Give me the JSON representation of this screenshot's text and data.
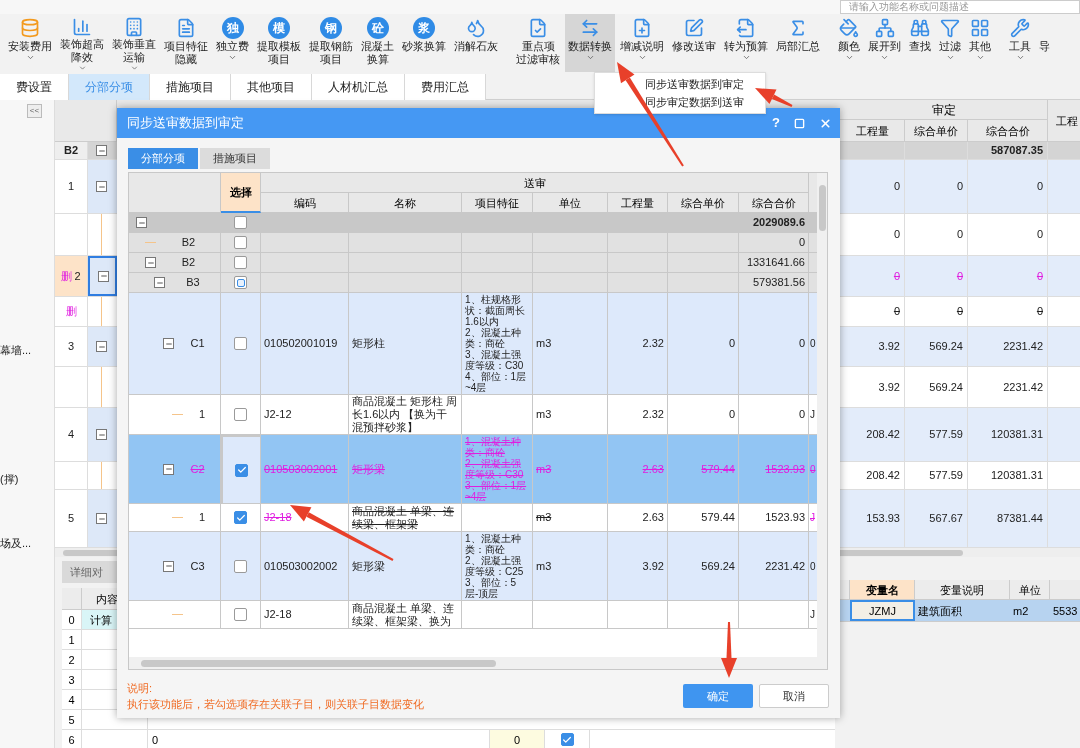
{
  "search": {
    "placeholder": "请输入功能名称或问题描述"
  },
  "toolbar": [
    [
      {
        "label": "安装费用",
        "dropdown": true,
        "selected": false
      },
      {
        "label": [
          "装饰超高",
          "降效"
        ],
        "dropdown": true,
        "selected": false
      },
      {
        "label": [
          "装饰垂直",
          "运输"
        ],
        "dropdown": true,
        "selected": false
      },
      {
        "label": [
          "项目特征",
          "隐藏"
        ],
        "dropdown": false,
        "selected": false
      },
      {
        "label": "独立费",
        "badge": "独",
        "dropdown": true,
        "selected": false
      },
      {
        "label": [
          "提取模板",
          "项目"
        ],
        "badge": "模",
        "dropdown": false,
        "selected": false
      },
      {
        "label": [
          "提取钢筋",
          "项目"
        ],
        "badge": "钢",
        "dropdown": false,
        "selected": false
      },
      {
        "label": [
          "混凝土",
          "换算"
        ],
        "badge": "砼",
        "dropdown": false,
        "selected": false
      },
      {
        "label": "砂浆换算",
        "badge": "浆",
        "dropdown": false,
        "selected": false
      },
      {
        "label": "消解石灰",
        "dropdown": false,
        "selected": false
      }
    ],
    [
      {
        "label": [
          "重点项",
          "过滤审核"
        ],
        "dropdown": false,
        "selected": false
      },
      {
        "label": "数据转换",
        "dropdown": true,
        "selected": true
      },
      {
        "label": "增减说明",
        "dropdown": true,
        "selected": false
      },
      {
        "label": "修改送审",
        "dropdown": false,
        "selected": false
      },
      {
        "label": "转为预算",
        "dropdown": true,
        "selected": false
      },
      {
        "label": "局部汇总",
        "dropdown": false,
        "selected": false
      }
    ],
    [
      {
        "label": "颜色",
        "dropdown": true,
        "selected": false
      },
      {
        "label": "展开到",
        "dropdown": true,
        "selected": false
      },
      {
        "label": "查找",
        "dropdown": false,
        "selected": false
      },
      {
        "label": "过滤",
        "dropdown": true,
        "selected": false
      },
      {
        "label": "其他",
        "dropdown": true,
        "selected": false
      }
    ],
    [
      {
        "label": "工具",
        "dropdown": true,
        "selected": false
      },
      {
        "label": "导",
        "dropdown": false,
        "selected": false
      }
    ]
  ],
  "menu": [
    "同步送审数据到审定",
    "同步审定数据到送审"
  ],
  "tabs": [
    {
      "label": "费设置",
      "selected": false
    },
    {
      "label": "分部分项",
      "selected": true
    },
    {
      "label": "措施项目",
      "selected": false
    },
    {
      "label": "其他项目",
      "selected": false
    },
    {
      "label": "人材机汇总",
      "selected": false
    },
    {
      "label": "费用汇总",
      "selected": false
    }
  ],
  "sidebar": {
    "collapse": "<<",
    "items": [
      "幕墙...",
      "(撑)",
      "场及..."
    ]
  },
  "grid": {
    "header_group": "审定",
    "columns": [
      "工程量",
      "综合单价",
      "综合合价"
    ],
    "column_cut": "工程",
    "rows": [
      {
        "kind": "summary",
        "number": "B2",
        "expanded": true,
        "selected": false,
        "deleted": false,
        "total": "587087.35"
      },
      {
        "kind": "item",
        "number": "1",
        "expanded": true,
        "selected": false,
        "deleted": false,
        "quantity": "0",
        "unit_price": "0",
        "total": "0"
      },
      {
        "kind": "sub",
        "selected": false,
        "deleted": false,
        "quantity": "0",
        "unit_price": "0",
        "total": "0"
      },
      {
        "kind": "item",
        "number": "2",
        "tag": "删",
        "expanded": true,
        "selected": true,
        "deleted": true,
        "quantity": "0",
        "unit_price": "0",
        "total": "0"
      },
      {
        "kind": "sub",
        "tag": "删",
        "selected": false,
        "deleted": true,
        "quantity": "0",
        "unit_price": "0",
        "total": "0"
      },
      {
        "kind": "item",
        "number": "3",
        "expanded": true,
        "selected": false,
        "deleted": false,
        "quantity": "3.92",
        "unit_price": "569.24",
        "total": "2231.42"
      },
      {
        "kind": "sub",
        "selected": false,
        "deleted": false,
        "quantity": "3.92",
        "unit_price": "569.24",
        "total": "2231.42"
      },
      {
        "kind": "item",
        "number": "4",
        "expanded": true,
        "selected": false,
        "deleted": false,
        "quantity": "208.42",
        "unit_price": "577.59",
        "total": "120381.31"
      },
      {
        "kind": "sub",
        "selected": false,
        "deleted": false,
        "quantity": "208.42",
        "unit_price": "577.59",
        "total": "120381.31"
      },
      {
        "kind": "item",
        "number": "5",
        "expanded": true,
        "selected": false,
        "deleted": false,
        "quantity": "153.93",
        "unit_price": "567.67",
        "total": "87381.44"
      }
    ]
  },
  "detail": {
    "tab": "详细对",
    "column": "内容",
    "rows": [
      {
        "number": "0",
        "content": "计算"
      },
      {
        "number": "1"
      },
      {
        "number": "2"
      },
      {
        "number": "3"
      },
      {
        "number": "4"
      },
      {
        "number": "5"
      },
      {
        "number": "6",
        "value": "0",
        "amount": "0",
        "checked": true
      }
    ]
  },
  "variables": {
    "columns": [
      "变量名",
      "变量说明",
      "单位"
    ],
    "rows": [
      {
        "name": "JZMJ",
        "description": "建筑面积",
        "unit": "m2",
        "value": "5533"
      }
    ]
  },
  "dialog": {
    "title": "同步送审数据到审定",
    "help": "?",
    "tabs": [
      {
        "label": "分部分项",
        "selected": true
      },
      {
        "label": "措施项目",
        "selected": false
      }
    ],
    "table": {
      "select_column": "选择",
      "group": "送审",
      "columns": [
        "编码",
        "名称",
        "项目特征",
        "单位",
        "工程量",
        "综合单价",
        "综合合价"
      ],
      "rows": [
        {
          "kind": "summary",
          "expanded": true,
          "checked": false,
          "partial": false,
          "selected": false,
          "deleted": false,
          "total": "2029089.6",
          "children": [
            {
              "kind": "group",
              "label": "B2",
              "checked": false,
              "partial": false,
              "selected": false,
              "deleted": false,
              "total": "0"
            },
            {
              "kind": "group",
              "label": "B2",
              "expanded": true,
              "checked": false,
              "partial": false,
              "selected": false,
              "deleted": false,
              "total": "1331641.66",
              "children": [
                {
                  "kind": "group",
                  "label": "B3",
                  "expanded": true,
                  "checked": false,
                  "partial": true,
                  "selected": false,
                  "deleted": false,
                  "total": "579381.56",
                  "children": [
                    {
                      "kind": "item",
                      "label": "C1",
                      "expanded": true,
                      "checked": false,
                      "partial": false,
                      "selected": false,
                      "deleted": false,
                      "code": "010502001019",
                      "name": "矩形柱",
                      "features": "1、柱规格形状：截面周长1.6以内\n2、混凝土种类：商砼\n3、混凝土强度等级：C30\n4、部位：1层~4层",
                      "unit": "m3",
                      "quantity": "2.32",
                      "unit_price": "0",
                      "total": "0",
                      "extra": "0",
                      "children": [
                        {
                          "kind": "sub",
                          "label": "1",
                          "checked": false,
                          "partial": false,
                          "selected": false,
                          "deleted": false,
                          "code": "J2-12",
                          "name": "商品混凝土 矩形柱 周长1.6以内 【换为干混预拌砂浆】",
                          "unit": "m3",
                          "quantity": "2.32",
                          "unit_price": "0",
                          "total": "0",
                          "extra": "J"
                        }
                      ]
                    },
                    {
                      "kind": "item",
                      "label": "C2",
                      "expanded": true,
                      "checked": true,
                      "partial": false,
                      "selected": true,
                      "deleted": true,
                      "code": "010503002001",
                      "name": "矩形梁",
                      "features": "1、混凝土种类：商砼\n2、混凝土强度等级：C30\n3、部位：1层~4层",
                      "unit": "m3",
                      "quantity": "2.63",
                      "unit_price": "579.44",
                      "total": "1523.93",
                      "extra": "0",
                      "children": [
                        {
                          "kind": "sub",
                          "label": "1",
                          "checked": true,
                          "partial": false,
                          "selected": false,
                          "deleted": true,
                          "code": "J2-18",
                          "name": "商品混凝土 单梁、连续梁、框架梁",
                          "unit": "m3",
                          "quantity": "2.63",
                          "unit_price": "579.44",
                          "total": "1523.93",
                          "extra": "J"
                        }
                      ]
                    },
                    {
                      "kind": "item",
                      "label": "C3",
                      "expanded": true,
                      "checked": false,
                      "partial": false,
                      "selected": false,
                      "deleted": false,
                      "code": "010503002002",
                      "name": "矩形梁",
                      "features": "1、混凝土种类：商砼\n2、混凝土强度等级：C25\n3、部位：5层-顶层",
                      "unit": "m3",
                      "quantity": "3.92",
                      "unit_price": "569.24",
                      "total": "2231.42",
                      "extra": "0",
                      "children": [
                        {
                          "kind": "sub",
                          "checked": false,
                          "partial": false,
                          "selected": false,
                          "deleted": false,
                          "code": "J2-18",
                          "name": "商品混凝土 单梁、连续梁、框架梁、换为",
                          "extra": "J"
                        }
                      ]
                    }
                  ]
                }
              ]
            }
          ]
        }
      ]
    },
    "note_title": "说明:",
    "note": "执行该功能后，若勾选项存在关联子目，则关联子目数据变化",
    "buttons": [
      {
        "label": "确定",
        "kind": "primary"
      },
      {
        "label": "取消",
        "kind": "secondary"
      }
    ]
  }
}
